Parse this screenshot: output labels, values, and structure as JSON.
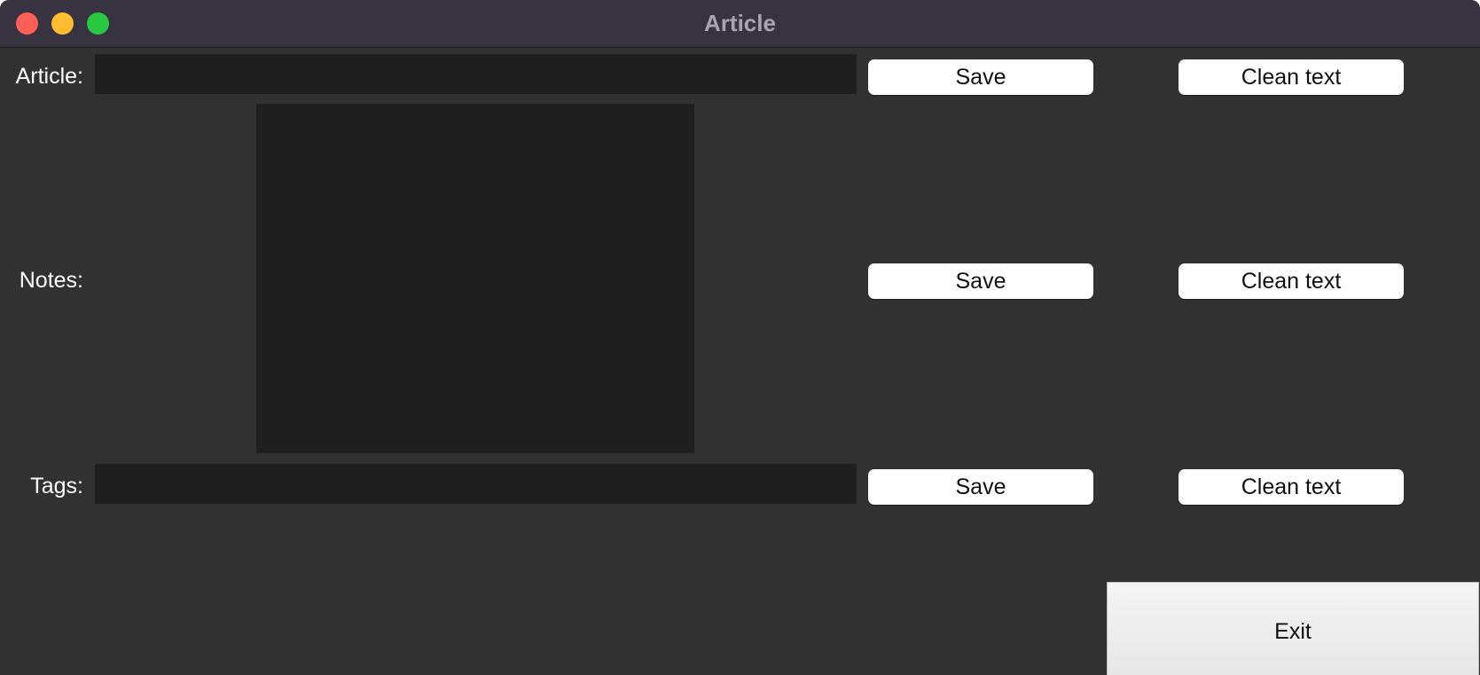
{
  "window": {
    "title": "Article"
  },
  "rows": {
    "article": {
      "label": "Article:",
      "value": "",
      "save_label": "Save",
      "clean_label": "Clean text"
    },
    "notes": {
      "label": "Notes:",
      "value": "",
      "save_label": "Save",
      "clean_label": "Clean text"
    },
    "tags": {
      "label": "Tags:",
      "value": "",
      "save_label": "Save",
      "clean_label": "Clean text"
    }
  },
  "exit_label": "Exit",
  "colors": {
    "window_bg": "#323232",
    "titlebar_bg": "#383341",
    "field_bg": "#1f1f1f",
    "button_bg": "#ffffff",
    "close": "#fe5f57",
    "minimize": "#febc2e",
    "maximize": "#28c840"
  }
}
